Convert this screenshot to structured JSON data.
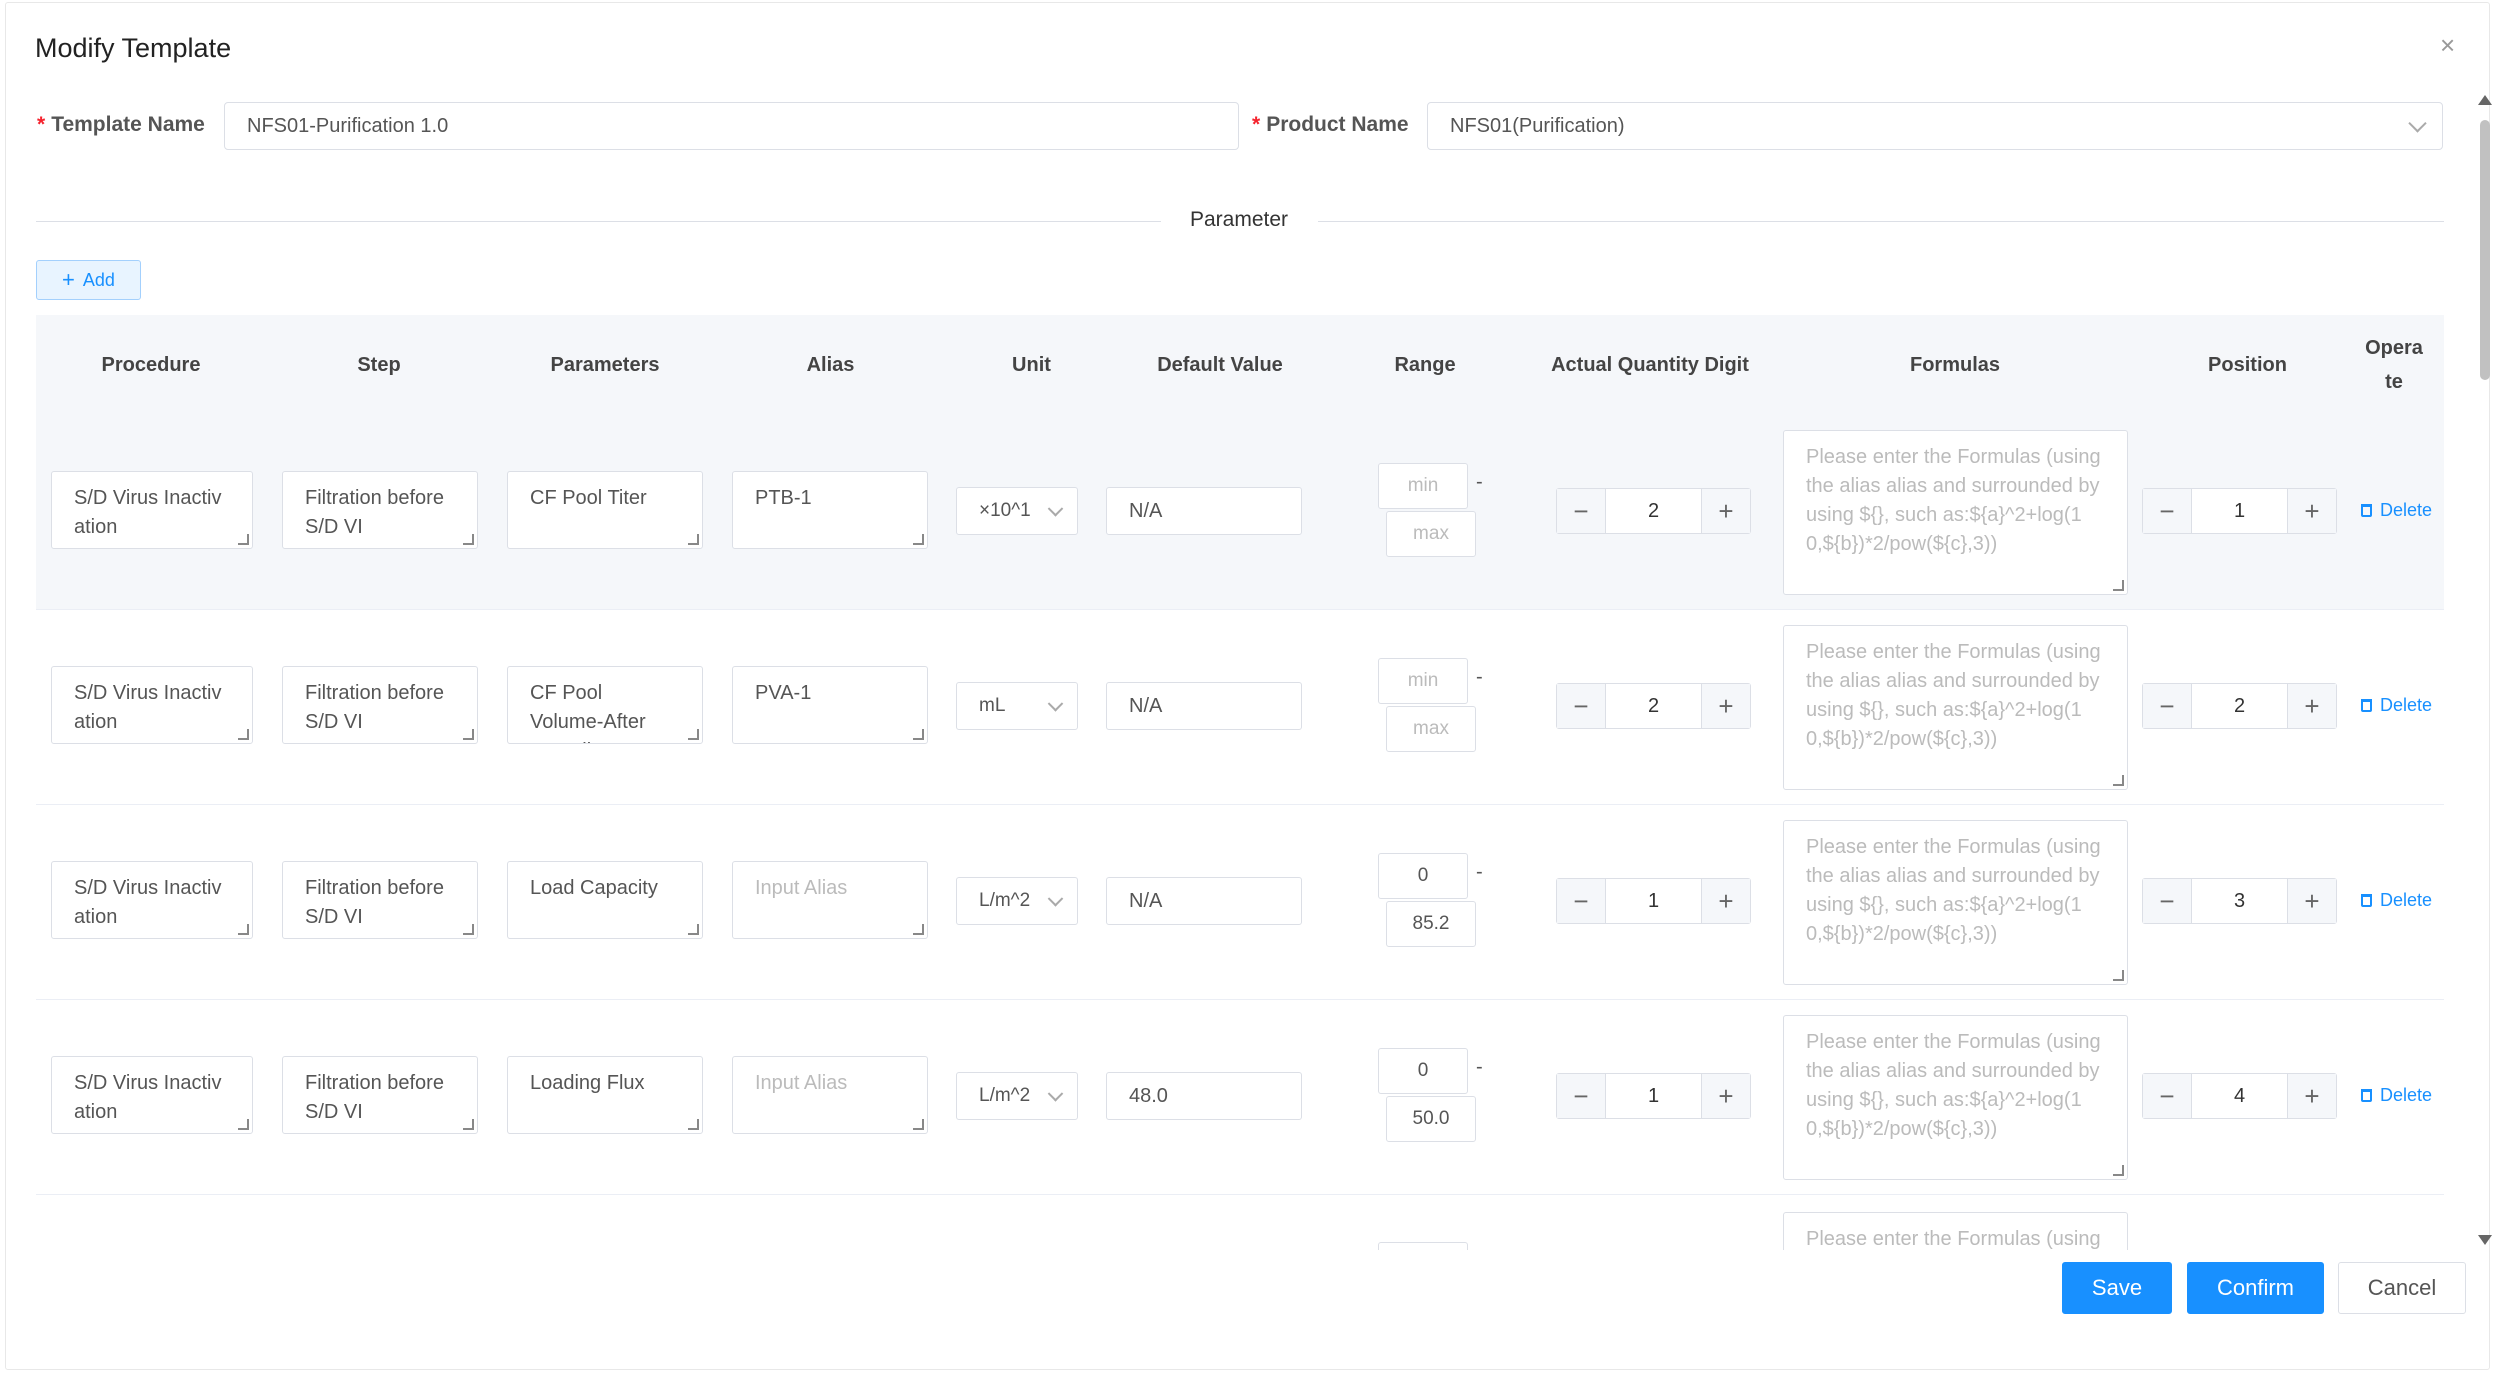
{
  "dialog": {
    "title": "Modify Template",
    "close": "×"
  },
  "form": {
    "template_name_label": "Template Name",
    "template_name_value": "NFS01-Purification 1.0",
    "product_name_label": "Product Name",
    "product_name_value": "NFS01(Purification)",
    "required_mark": "*"
  },
  "section": {
    "divider": "Parameter",
    "add_label": "Add",
    "add_icon": "+"
  },
  "table": {
    "headers": [
      "Procedure",
      "Step",
      "Parameters",
      "Alias",
      "Unit",
      "Default Value",
      "Range",
      "Actual Quantity Digit",
      "Formulas",
      "Position",
      "Opera te"
    ],
    "alias_placeholder": "Input Alias",
    "min_placeholder": "min",
    "max_placeholder": "max",
    "formula_placeholder": "Please enter the Formulas (using the alias alias and surrounded by using ${}, such as:${a}^2+log(1 0,${b})*2/pow(${c},3))",
    "formula_placeholder_partial": "Please enter the Formulas (using",
    "delete_label": "Delete",
    "range_dash": "-",
    "minus": "−",
    "plus": "+",
    "rows": [
      {
        "procedure": "S/D Virus Inactiv ation",
        "step": "Filtration before S/D VI",
        "parameter": "CF Pool Titer",
        "alias": "PTB-1",
        "unit": "×10^1",
        "default": "N/A",
        "min": "",
        "max": "",
        "digit": "2",
        "position": "1"
      },
      {
        "procedure": "S/D Virus Inactiv ation",
        "step": "Filtration before S/D VI",
        "parameter": "CF Pool Volume-After Sampling",
        "alias": "PVA-1",
        "unit": "mL",
        "default": "N/A",
        "min": "",
        "max": "",
        "digit": "2",
        "position": "2"
      },
      {
        "procedure": "S/D Virus Inactiv ation",
        "step": "Filtration before S/D VI",
        "parameter": "Load Capacity",
        "alias": "",
        "unit": "L/m^2",
        "default": "N/A",
        "min": "0",
        "max": "85.2",
        "digit": "1",
        "position": "3"
      },
      {
        "procedure": "S/D Virus Inactiv ation",
        "step": "Filtration before S/D VI",
        "parameter": "Loading Flux",
        "alias": "",
        "unit": "L/m^2",
        "default": "48.0",
        "min": "0",
        "max": "50.0",
        "digit": "1",
        "position": "4"
      }
    ]
  },
  "footer": {
    "save": "Save",
    "confirm": "Confirm",
    "cancel": "Cancel"
  },
  "colors": {
    "primary": "#1890ff",
    "required": "#f5222d",
    "header_bg": "#f5f7fa"
  },
  "icons": {
    "close": "close-icon",
    "add": "plus-icon",
    "delete": "trash-icon",
    "select": "chevron-down-icon"
  }
}
